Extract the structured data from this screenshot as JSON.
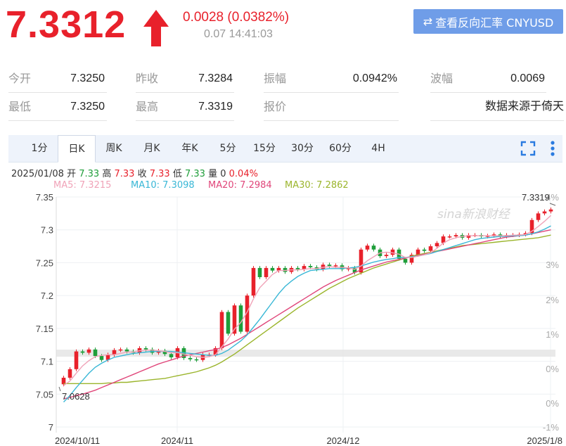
{
  "quote": {
    "price": "7.3312",
    "change": "0.0028 (0.0382%)",
    "time": "0.07 14:41:03",
    "reverse_btn": "查看反向汇率 CNYUSD",
    "colors": {
      "up": "#e8212b",
      "down": "#1f9e3a",
      "button": "#6f9de8"
    }
  },
  "stats": [
    [
      {
        "label": "今开",
        "value": "7.3250"
      },
      {
        "label": "昨收",
        "value": "7.3284"
      },
      {
        "label": "振幅",
        "value": "0.0942%"
      },
      {
        "label": "波幅",
        "value": "0.0069"
      }
    ],
    [
      {
        "label": "最低",
        "value": "7.3250"
      },
      {
        "label": "最高",
        "value": "7.3319"
      },
      {
        "label": "报价",
        "value": ""
      },
      {
        "label": "",
        "value": "数据来源于倚天"
      }
    ]
  ],
  "tabs": [
    "1分",
    "日K",
    "周K",
    "月K",
    "年K",
    "5分",
    "15分",
    "30分",
    "60分",
    "4H"
  ],
  "active_tab": "日K",
  "ohlc": {
    "date": "2025/01/08",
    "open_label": "开",
    "open": "7.33",
    "high_label": "高",
    "high": "7.33",
    "close_label": "收",
    "close": "7.33",
    "low_label": "低",
    "low": "7.33",
    "vol_label": "量",
    "vol": "0",
    "pct": "0.04%"
  },
  "ma_legend": [
    {
      "label": "MA5: 7.3215",
      "color": "#f0a3b8"
    },
    {
      "label": "MA10: 7.3098",
      "color": "#39b7d6"
    },
    {
      "label": "MA20: 7.2984",
      "color": "#e0467a"
    },
    {
      "label": "MA30: 7.2862",
      "color": "#9bb52c"
    }
  ],
  "watermark": "sina新浪财经",
  "chart_data": {
    "type": "candlestick",
    "y_ticks": [
      "7.35",
      "7.3",
      "7.25",
      "7.2",
      "7.15",
      "7.1",
      "7.05",
      "7"
    ],
    "pct_ticks": [
      "4%",
      "3%",
      "2%",
      "1%",
      "0%",
      "0%",
      "-1%"
    ],
    "x_labels": [
      "2024/10/11",
      "2024/11",
      "2024/12",
      "2025/1/8"
    ],
    "ylim": [
      7.0,
      7.35
    ],
    "max_label": "7.3319",
    "min_label": "7.0628",
    "candles": [
      [
        7.065,
        7.075
      ],
      [
        7.075,
        7.088
      ],
      [
        7.088,
        7.115
      ],
      [
        7.115,
        7.113
      ],
      [
        7.113,
        7.118
      ],
      [
        7.118,
        7.108
      ],
      [
        7.108,
        7.102
      ],
      [
        7.102,
        7.11
      ],
      [
        7.11,
        7.117
      ],
      [
        7.117,
        7.118
      ],
      [
        7.118,
        7.115
      ],
      [
        7.115,
        7.113
      ],
      [
        7.113,
        7.12
      ],
      [
        7.12,
        7.118
      ],
      [
        7.118,
        7.113
      ],
      [
        7.113,
        7.116
      ],
      [
        7.116,
        7.111
      ],
      [
        7.111,
        7.106
      ],
      [
        7.106,
        7.12
      ],
      [
        7.12,
        7.105
      ],
      [
        7.105,
        7.103
      ],
      [
        7.103,
        7.102
      ],
      [
        7.102,
        7.11
      ],
      [
        7.11,
        7.11
      ],
      [
        7.11,
        7.12
      ],
      [
        7.12,
        7.175
      ],
      [
        7.175,
        7.142
      ],
      [
        7.142,
        7.185
      ],
      [
        7.185,
        7.145
      ],
      [
        7.145,
        7.2
      ],
      [
        7.2,
        7.242
      ],
      [
        7.242,
        7.228
      ],
      [
        7.228,
        7.242
      ],
      [
        7.242,
        7.238
      ],
      [
        7.238,
        7.242
      ],
      [
        7.242,
        7.236
      ],
      [
        7.236,
        7.242
      ],
      [
        7.242,
        7.24
      ],
      [
        7.24,
        7.245
      ],
      [
        7.245,
        7.243
      ],
      [
        7.243,
        7.24
      ],
      [
        7.24,
        7.247
      ],
      [
        7.247,
        7.245
      ],
      [
        7.245,
        7.246
      ],
      [
        7.246,
        7.24
      ],
      [
        7.24,
        7.242
      ],
      [
        7.242,
        7.235
      ],
      [
        7.235,
        7.27
      ],
      [
        7.27,
        7.276
      ],
      [
        7.276,
        7.27
      ],
      [
        7.27,
        7.26
      ],
      [
        7.26,
        7.262
      ],
      [
        7.262,
        7.27
      ],
      [
        7.27,
        7.256
      ],
      [
        7.256,
        7.25
      ],
      [
        7.25,
        7.262
      ],
      [
        7.262,
        7.27
      ],
      [
        7.27,
        7.268
      ],
      [
        7.268,
        7.275
      ],
      [
        7.275,
        7.28
      ],
      [
        7.28,
        7.29
      ],
      [
        7.29,
        7.29
      ],
      [
        7.29,
        7.292
      ],
      [
        7.292,
        7.288
      ],
      [
        7.288,
        7.292
      ],
      [
        7.292,
        7.292
      ],
      [
        7.292,
        7.29
      ],
      [
        7.29,
        7.291
      ],
      [
        7.291,
        7.293
      ],
      [
        7.293,
        7.29
      ],
      [
        7.29,
        7.292
      ],
      [
        7.292,
        7.292
      ],
      [
        7.292,
        7.293
      ],
      [
        7.293,
        7.295
      ],
      [
        7.295,
        7.315
      ],
      [
        7.315,
        7.325
      ],
      [
        7.325,
        7.328
      ],
      [
        7.328,
        7.331
      ]
    ],
    "ma5": [
      7.063,
      7.07,
      7.082,
      7.093,
      7.101,
      7.107,
      7.109,
      7.11,
      7.11,
      7.112,
      7.114,
      7.114,
      7.116,
      7.117,
      7.117,
      7.116,
      7.115,
      7.113,
      7.113,
      7.111,
      7.109,
      7.107,
      7.106,
      7.107,
      7.11,
      7.122,
      7.134,
      7.149,
      7.159,
      7.175,
      7.195,
      7.212,
      7.222,
      7.232,
      7.238,
      7.238,
      7.239,
      7.239,
      7.24,
      7.241,
      7.241,
      7.243,
      7.244,
      7.243,
      7.243,
      7.242,
      7.24,
      7.245,
      7.253,
      7.259,
      7.265,
      7.266,
      7.265,
      7.263,
      7.258,
      7.258,
      7.26,
      7.262,
      7.265,
      7.272,
      7.28,
      7.285,
      7.288,
      7.29,
      7.291,
      7.291,
      7.291,
      7.291,
      7.291,
      7.291,
      7.291,
      7.292,
      7.292,
      7.293,
      7.298,
      7.305,
      7.313,
      7.322
    ],
    "ma10": [
      7.038,
      7.048,
      7.06,
      7.071,
      7.082,
      7.091,
      7.097,
      7.102,
      7.106,
      7.108,
      7.11,
      7.112,
      7.113,
      7.114,
      7.115,
      7.115,
      7.115,
      7.115,
      7.114,
      7.113,
      7.112,
      7.111,
      7.11,
      7.109,
      7.109,
      7.112,
      7.117,
      7.124,
      7.131,
      7.14,
      7.152,
      7.164,
      7.177,
      7.19,
      7.203,
      7.214,
      7.222,
      7.229,
      7.234,
      7.238,
      7.239,
      7.24,
      7.241,
      7.241,
      7.241,
      7.242,
      7.243,
      7.245,
      7.248,
      7.251,
      7.253,
      7.255,
      7.256,
      7.258,
      7.258,
      7.259,
      7.26,
      7.262,
      7.264,
      7.267,
      7.27,
      7.273,
      7.276,
      7.279,
      7.282,
      7.285,
      7.287,
      7.288,
      7.289,
      7.29,
      7.29,
      7.291,
      7.291,
      7.292,
      7.294,
      7.297,
      7.301,
      7.306
    ],
    "ma20": [
      7.043,
      7.045,
      7.048,
      7.05,
      7.053,
      7.056,
      7.06,
      7.064,
      7.068,
      7.072,
      7.076,
      7.08,
      7.084,
      7.088,
      7.092,
      7.096,
      7.099,
      7.102,
      7.105,
      7.108,
      7.11,
      7.112,
      7.114,
      7.116,
      7.118,
      7.121,
      7.125,
      7.13,
      7.135,
      7.141,
      7.147,
      7.153,
      7.159,
      7.165,
      7.171,
      7.177,
      7.183,
      7.189,
      7.195,
      7.201,
      7.207,
      7.213,
      7.218,
      7.223,
      7.227,
      7.231,
      7.235,
      7.239,
      7.242,
      7.245,
      7.248,
      7.251,
      7.253,
      7.255,
      7.257,
      7.259,
      7.261,
      7.263,
      7.265,
      7.267,
      7.269,
      7.271,
      7.273,
      7.275,
      7.277,
      7.279,
      7.281,
      7.283,
      7.285,
      7.287,
      7.289,
      7.29,
      7.291,
      7.292,
      7.294,
      7.296,
      7.298,
      7.3
    ],
    "ma30": [
      7.066,
      7.066,
      7.066,
      7.066,
      7.066,
      7.066,
      7.066,
      7.067,
      7.067,
      7.068,
      7.068,
      7.069,
      7.07,
      7.071,
      7.072,
      7.073,
      7.074,
      7.076,
      7.078,
      7.08,
      7.082,
      7.084,
      7.087,
      7.09,
      7.094,
      7.099,
      7.105,
      7.111,
      7.118,
      7.125,
      7.132,
      7.139,
      7.146,
      7.153,
      7.16,
      7.167,
      7.174,
      7.181,
      7.187,
      7.193,
      7.199,
      7.205,
      7.211,
      7.216,
      7.221,
      7.226,
      7.23,
      7.234,
      7.238,
      7.242,
      7.245,
      7.248,
      7.251,
      7.254,
      7.257,
      7.26,
      7.262,
      7.264,
      7.266,
      7.268,
      7.27,
      7.272,
      7.274,
      7.276,
      7.277,
      7.278,
      7.279,
      7.28,
      7.281,
      7.282,
      7.283,
      7.284,
      7.285,
      7.286,
      7.287,
      7.288,
      7.29,
      7.292
    ]
  }
}
